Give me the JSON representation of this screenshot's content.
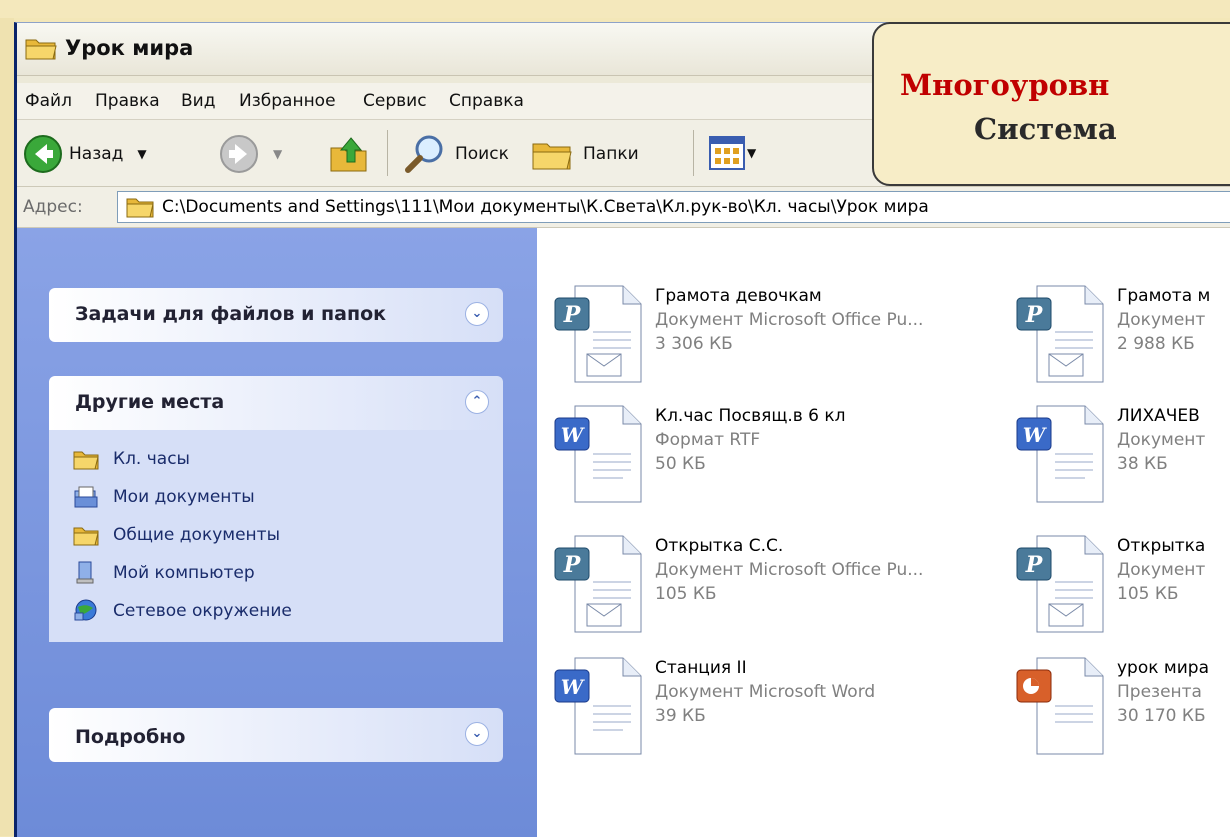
{
  "window": {
    "title": "Урок мира"
  },
  "menu": [
    "Файл",
    "Правка",
    "Вид",
    "Избранное",
    "Сервис",
    "Справка"
  ],
  "toolbar": {
    "back": "Назад",
    "search": "Поиск",
    "folders": "Папки"
  },
  "address": {
    "label": "Адрес:",
    "path": "C:\\Documents and Settings\\111\\Мои документы\\К.Света\\Кл.рук-во\\Кл. часы\\Урок мира"
  },
  "panels": {
    "tasks": {
      "title": "Задачи для файлов и папок"
    },
    "places": {
      "title": "Другие места",
      "items": [
        {
          "label": "Кл. часы",
          "icon": "folder-icon"
        },
        {
          "label": "Мои документы",
          "icon": "my-documents-icon"
        },
        {
          "label": "Общие документы",
          "icon": "folder-icon"
        },
        {
          "label": "Мой компьютер",
          "icon": "computer-icon"
        },
        {
          "label": "Сетевое окружение",
          "icon": "network-icon"
        }
      ]
    },
    "details": {
      "title": "Подробно"
    }
  },
  "files": [
    {
      "name": "Грамота девочкам",
      "desc": "Документ Microsoft Office Pu...",
      "size": "3 306 КБ",
      "icon": "publisher-icon"
    },
    {
      "name": "Грамота м",
      "desc": "Документ",
      "size": "2 988 КБ",
      "icon": "publisher-icon"
    },
    {
      "name": "Кл.час Посвящ.в 6 кл",
      "desc": "Формат RTF",
      "size": "50 КБ",
      "icon": "word-icon"
    },
    {
      "name": "ЛИХАЧЕВ",
      "desc": "Документ",
      "size": "38 КБ",
      "icon": "word-icon"
    },
    {
      "name": "Открытка С.С.",
      "desc": "Документ Microsoft Office Pu...",
      "size": "105 КБ",
      "icon": "publisher-icon"
    },
    {
      "name": "Открытка",
      "desc": "Документ",
      "size": "105 КБ",
      "icon": "publisher-icon"
    },
    {
      "name": "Станция II",
      "desc": "Документ Microsoft Word",
      "size": "39 КБ",
      "icon": "word-icon"
    },
    {
      "name": "урок мира",
      "desc": "Презента",
      "size": "30 170 КБ",
      "icon": "powerpoint-icon"
    }
  ],
  "callout": {
    "line1": "Многоуровн",
    "line2": "Система"
  },
  "colors": {
    "accent_red": "#c00000",
    "pane_blue": "#7b99e1"
  }
}
